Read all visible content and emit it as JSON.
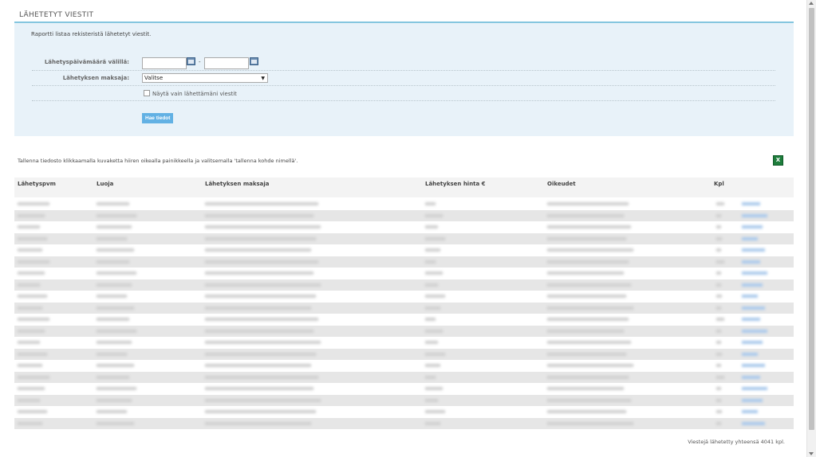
{
  "page": {
    "title": "LÄHETETYT VIESTIT",
    "description": "Raportti listaa rekisteristä lähetetyt viestit."
  },
  "filters": {
    "date_range_label": "Lähetyspäivämäärä välillä:",
    "date_from_value": "",
    "date_to_value": "",
    "range_separator": "-",
    "payer_label": "Lähetyksen maksaja:",
    "payer_selected": "Valitse",
    "only_mine_label": "Näytä vain lähettämäni viestit",
    "only_mine_checked": false,
    "fetch_button": "Hae tiedot"
  },
  "save_note": "Tallenna tiedosto klikkaamalla kuvaketta hiiren oikealla painikkeella ja valitsemalla 'tallenna kohde nimellä'.",
  "table": {
    "columns": [
      "Lähetyspvm",
      "Luoja",
      "Lähetyksen maksaja",
      "Lähetyksen hinta €",
      "Oikeudet",
      "Kpl"
    ],
    "row_count": 20,
    "rows_blurred": true
  },
  "footer": "Viestejä lähetetty yhteensä 4041 kpl.",
  "icons": {
    "calendar": "calendar-icon",
    "excel": "excel-icon",
    "dropdown": "chevron-down-icon"
  },
  "colors": {
    "accent_line": "#84c6df",
    "panel_bg": "#e8f2f9",
    "button_bg": "#62b1e4"
  }
}
